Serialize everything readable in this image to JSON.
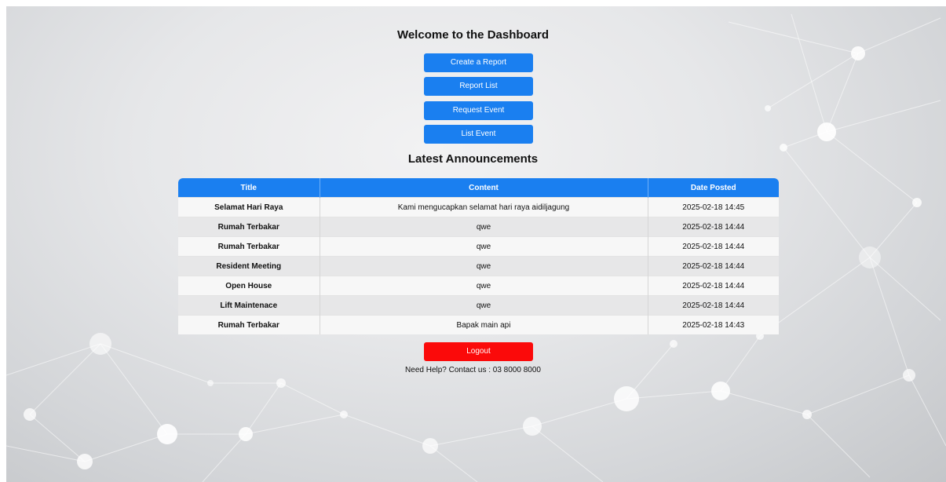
{
  "header": {
    "title": "Welcome to the Dashboard"
  },
  "actions": {
    "create_report": "Create a Report",
    "report_list": "Report List",
    "request_event": "Request Event",
    "list_event": "List Event"
  },
  "announcements": {
    "heading": "Latest Announcements",
    "columns": [
      "Title",
      "Content",
      "Date Posted"
    ],
    "rows": [
      [
        "Selamat Hari Raya",
        "Kami mengucapkan selamat hari raya aidiljagung",
        "2025-02-18 14:45"
      ],
      [
        "Rumah Terbakar",
        "qwe",
        "2025-02-18 14:44"
      ],
      [
        "Rumah Terbakar",
        "qwe",
        "2025-02-18 14:44"
      ],
      [
        "Resident Meeting",
        "qwe",
        "2025-02-18 14:44"
      ],
      [
        "Open House",
        "qwe",
        "2025-02-18 14:44"
      ],
      [
        "Lift Maintenace",
        "qwe",
        "2025-02-18 14:44"
      ],
      [
        "Rumah Terbakar",
        "Bapak main api",
        "2025-02-18 14:43"
      ]
    ]
  },
  "footer": {
    "logout_label": "Logout",
    "help_text": "Need Help? Contact us : 03 8000 8000"
  },
  "colors": {
    "primary": "#1a7ff0",
    "danger": "#fb0a0a",
    "row_light": "#f7f7f7",
    "row_dark": "#e7e7e8"
  }
}
